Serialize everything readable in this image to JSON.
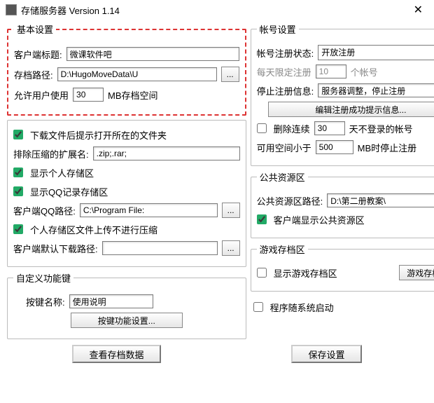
{
  "window": {
    "title": "存储服务器  Version 1.14"
  },
  "basic": {
    "legend": "基本设置",
    "client_title_label": "客户端标题:",
    "client_title_value": "微课软件吧",
    "save_path_label": "存档路径:",
    "save_path_value": "D:\\HugoMoveData\\U",
    "browse": "...",
    "allow_label": "允许用户使用",
    "allow_value": "30",
    "allow_suffix": "MB存档空间"
  },
  "leftExtra": {
    "cb_open_folder": "下载文件后提示打开所在的文件夹",
    "exclude_ext_label": "排除压缩的扩展名:",
    "exclude_ext_value": ".zip;.rar;",
    "cb_show_personal": "显示个人存储区",
    "cb_show_qq": "显示QQ记录存储区",
    "qq_path_label": "客户端QQ路径:",
    "qq_path_value": "C:\\Program File:",
    "cb_no_compress": "个人存储区文件上传不进行压缩",
    "default_dl_label": "客户端默认下载路径:",
    "default_dl_value": ""
  },
  "customKeys": {
    "legend": "自定义功能键",
    "key_name_label": "按键名称:",
    "key_name_value": "使用说明",
    "btn_config": "按键功能设置..."
  },
  "account": {
    "legend": "帐号设置",
    "reg_state_label": "帐号注册状态:",
    "reg_state_value": "开放注册",
    "daily_limit_label": "每天限定注册",
    "daily_limit_value": "10",
    "daily_limit_suffix": "个帐号",
    "stop_info_label": "停止注册信息:",
    "stop_info_value": "服务器调整，停止注册",
    "btn_edit_success": "编辑注册成功提示信息...",
    "cb_delete_inactive": "删除连续",
    "delete_inactive_value": "30",
    "delete_inactive_suffix": "天不登录的帐号",
    "space_lt_label": "可用空间小于",
    "space_lt_value": "500",
    "space_lt_suffix": "MB时停止注册"
  },
  "publicRes": {
    "legend": "公共资源区",
    "path_label": "公共资源区路径:",
    "path_value": "D:\\第二册教案\\",
    "cb_show": "客户端显示公共资源区"
  },
  "gameSave": {
    "legend": "游戏存档区",
    "cb_show": "显示游戏存档区",
    "btn_config": "游戏存档设置"
  },
  "cb_autostart": "程序随系统启动",
  "footer": {
    "btn_view": "查看存档数据",
    "btn_save": "保存设置"
  }
}
